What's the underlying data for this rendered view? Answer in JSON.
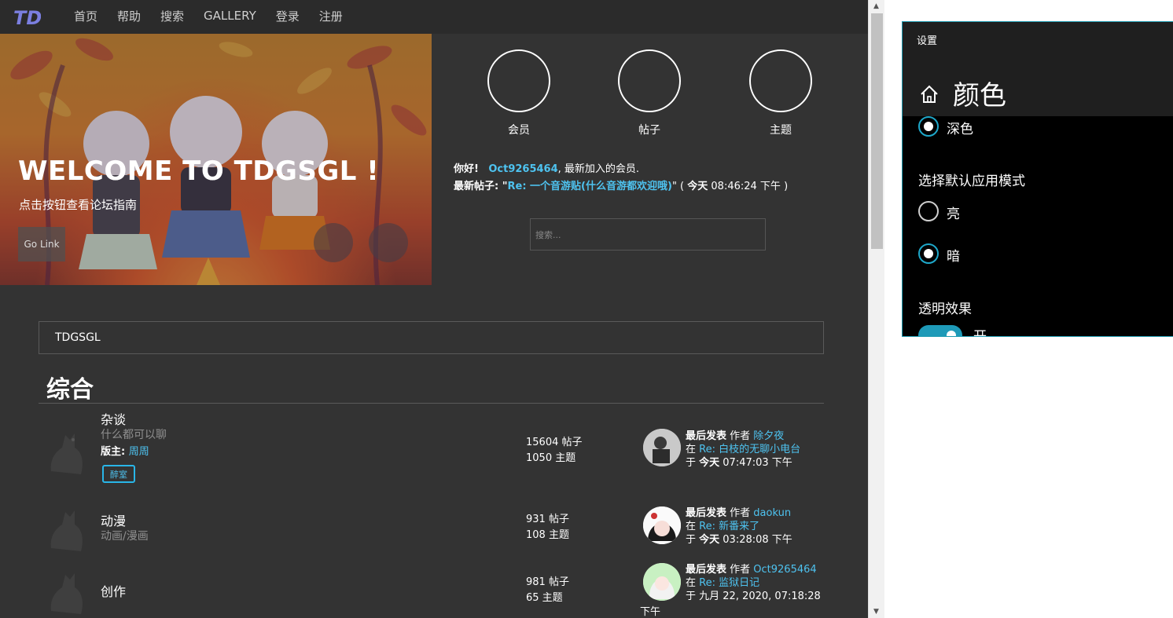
{
  "nav": {
    "logo": "TD",
    "links": [
      "首页",
      "帮助",
      "搜索",
      "GALLERY",
      "登录",
      "注册"
    ]
  },
  "hero": {
    "title": "WELCOME TO TDGSGL !",
    "subtitle": "点击按钮查看论坛指南",
    "go_link": "Go Link",
    "circle_icon_1": "",
    "circle_icon_2": ""
  },
  "stats": [
    {
      "label": "会员",
      "icon": ""
    },
    {
      "label": "帖子",
      "icon": ""
    },
    {
      "label": "主题",
      "icon": ""
    }
  ],
  "welcome": {
    "greeting": "你好!",
    "newest_member": "Oct9265464",
    "newest_suffix": ", 最新加入的会员.",
    "latest_post_prefix": "最新帖子: \"",
    "latest_post_title": "Re: 一个音游贴(什么音游都欢迎哦)",
    "latest_post_suffix_open": "\" ( ",
    "latest_post_today": "今天",
    "latest_post_time": " 08:46:24 下午 )"
  },
  "search": {
    "placeholder": "搜索...",
    "button_icon": ""
  },
  "breadcrumb": {
    "icon": "",
    "label": "TDGSGL"
  },
  "section": {
    "title": "综合"
  },
  "forums": [
    {
      "name": "杂谈",
      "desc": "什么都可以聊",
      "moderator_label": "版主: ",
      "moderator": "周周",
      "tag": "醉室",
      "posts": " 15604 帖子",
      "topics": " 1050 主题",
      "last_label": "最后发表",
      "by_label": " 作者 ",
      "author": "除夕夜",
      "in_label": "在 ",
      "thread": "Re: 白枝的无聊小电台",
      "at_label": "于 ",
      "day": "今天",
      "time": " 07:47:03 下午"
    },
    {
      "name": "动漫",
      "desc": "动画/漫画",
      "posts": " 931 帖子",
      "topics": " 108 主题",
      "last_label": "最后发表",
      "by_label": " 作者 ",
      "author": "daokun",
      "in_label": "在 ",
      "thread": "Re: 新番来了",
      "at_label": "于 ",
      "day": "今天",
      "time": " 03:28:08 下午"
    },
    {
      "name": "创作",
      "posts": " 981 帖子",
      "topics": " 65 主题",
      "last_label": "最后发表",
      "by_label": " 作者 ",
      "author": "Oct9265464",
      "in_label": "在 ",
      "thread": "Re: 监狱日记",
      "at_label": "于 ",
      "date": "九月 22, 2020, 07:18:28",
      "time_tail": "下午"
    }
  ],
  "settings": {
    "window_title": "设置",
    "heading": "颜色",
    "dark_option": "深色",
    "app_mode_label": "选择默认应用模式",
    "light": "亮",
    "dark": "暗",
    "transparency_label": "透明效果",
    "toggle_state": "开"
  },
  "colors": {
    "accent": "#1e9ab8",
    "link": "#4ec3f0",
    "page_bg": "#333333"
  }
}
